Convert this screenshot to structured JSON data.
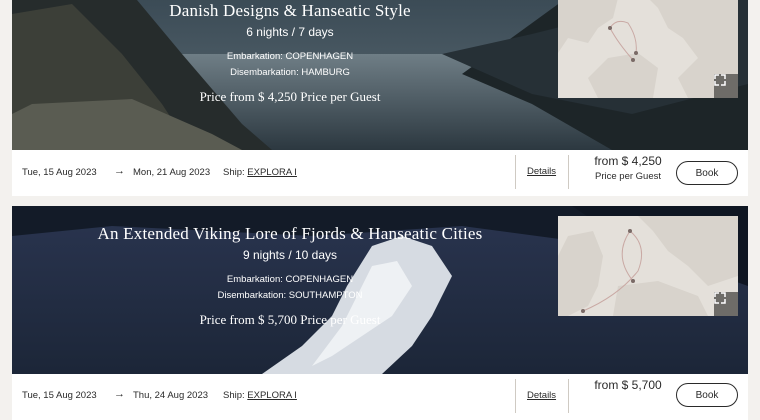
{
  "cruises": [
    {
      "title": "Danish Designs & Hanseatic Style",
      "nights": "6 nights / 7 days",
      "embarkation": "Embarkation: COPENHAGEN",
      "disembarkation": "Disembarkation: HAMBURG",
      "price_line": "Price from $ 4,250 Price per Guest",
      "start_date": "Tue, 15 Aug 2023",
      "arrow": "→",
      "end_date": "Mon, 21 Aug 2023",
      "ship_label": "Ship:",
      "ship_name": "EXPLORA I",
      "details_label": "Details",
      "price_from": "from $ 4,250",
      "price_per": "Price per Guest",
      "book_label": "Book"
    },
    {
      "title": "An Extended Viking Lore of Fjords & Hanseatic Cities",
      "nights": "9 nights / 10 days",
      "embarkation": "Embarkation: COPENHAGEN",
      "disembarkation": "Disembarkation: SOUTHAMPTON",
      "price_line": "Price from $ 5,700 Price per Guest",
      "start_date": "Tue, 15 Aug 2023",
      "arrow": "→",
      "end_date": "Thu, 24 Aug 2023",
      "ship_label": "Ship:",
      "ship_name": "EXPLORA I",
      "details_label": "Details",
      "price_from": "from $ 5,700",
      "price_per": "",
      "book_label": "Book"
    }
  ],
  "icons": {
    "expand": "expand-icon",
    "arrow": "arrow-right"
  },
  "colors": {
    "accent": "#2a2a2a",
    "background": "#f3f1ee",
    "map_land": "#d8d3cc",
    "map_sea": "#e4e0da"
  }
}
